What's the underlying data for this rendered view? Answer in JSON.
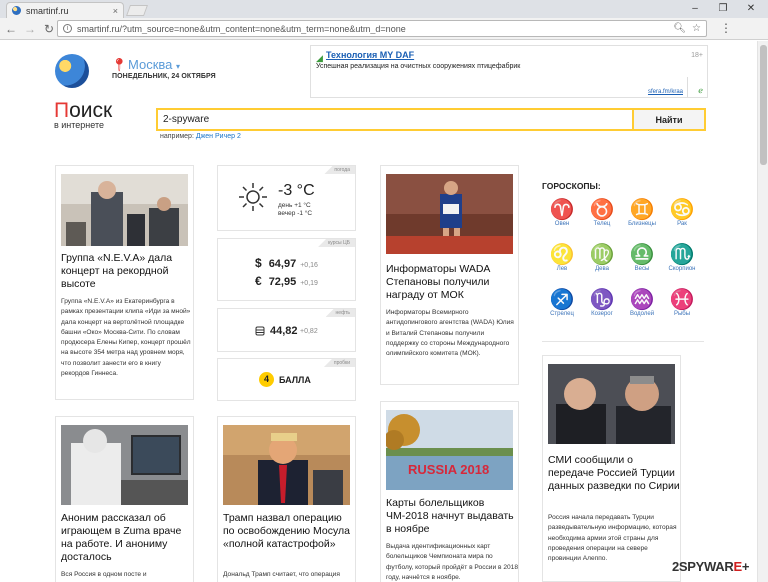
{
  "browser": {
    "tab_title": "smartinf.ru",
    "tab_close": "×",
    "url": "smartinf.ru/?utm_source=none&utm_content=none&utm_term=none&utm_d=none",
    "window_controls": [
      "–",
      "❐",
      "✕"
    ]
  },
  "header": {
    "city": "Москва",
    "date": "ПОНЕДЕЛЬНИК, 24 ОКТЯБРЯ"
  },
  "ad": {
    "title": "Технология MY DAF",
    "text": "Успешная реализация на очистных сооружениях птицефабрик",
    "age": "18+",
    "domain": "sfera.fm/kraa"
  },
  "brand": {
    "first_letter": "П",
    "rest": "оиск",
    "subtitle": "в интернете"
  },
  "search": {
    "value": "2-spyware",
    "button": "Найти",
    "example_prefix": "например:",
    "example_link": "Джен Ричер 2"
  },
  "news": [
    {
      "title": "Группа «N.E.V.A» дала концерт на рекордной высоте",
      "text": "Группа «N.E.V.A» из Екатеринбурга в рамках презентации клипа «Иди за мной» дала концерт на вертолётной площадке башни «Око» Москва-Сити. По словам продюсера Елены Кипер, концерт прошёл на высоте 354 метра над уровнем моря, что позволит занести его в книгу рекордов Гиннеса."
    },
    {
      "title": "Информаторы WADA Степановы получили награду от МОК",
      "text": "Информаторы Всемирного антидопингового агентства (WADA) Юлия и Виталий Степановы получили поддержку со стороны Международного олимпийского комитета (МОК)."
    },
    {
      "title": "Аноним рассказал об играющем в Zuma враче на работе. И анониму досталось",
      "text": "Вся Россия в одном посте и"
    },
    {
      "title": "Трамп назвал операцию по освобождению Мосула «полной катастрофой»",
      "text": "Дональд Трамп считает, что операция"
    },
    {
      "title": "Карты болельщиков ЧМ-2018 начнут выдавать в ноябре",
      "text": "Выдача идентификационных карт болельщиков Чемпионата мира по футболу, который пройдёт в России в 2018 году, начнётся в ноябре."
    },
    {
      "title": "СМИ сообщили о передаче Россией Турции данных разведки по Сирии",
      "text": "Россия начала передавать Турции разведывательную информацию, которая необходима армии этой страны для проведения операции на севере провинции Алеппо."
    }
  ],
  "weather": {
    "tag": "погода",
    "temp": "-3 °C",
    "day": "день +1 °C",
    "evening": "вечер -1 °C"
  },
  "rates": {
    "tag": "курсы ЦБ",
    "usd_symbol": "$",
    "usd": "64,97",
    "usd_change": "+0,16",
    "eur_symbol": "€",
    "eur": "72,95",
    "eur_change": "+0,19"
  },
  "oil": {
    "tag": "нефть",
    "value": "44,82",
    "change": "+0,82"
  },
  "traffic": {
    "tag": "пробки",
    "score": "4",
    "label": "БАЛЛА"
  },
  "horoscope": {
    "title": "ГОРОСКОПЫ:",
    "signs": [
      {
        "glyph": "♈",
        "name": "Овен"
      },
      {
        "glyph": "♉",
        "name": "Телец"
      },
      {
        "glyph": "♊",
        "name": "Близнецы"
      },
      {
        "glyph": "♋",
        "name": "Рак"
      },
      {
        "glyph": "♌",
        "name": "Лев"
      },
      {
        "glyph": "♍",
        "name": "Дева"
      },
      {
        "glyph": "♎",
        "name": "Весы"
      },
      {
        "glyph": "♏",
        "name": "Скорпион"
      },
      {
        "glyph": "♐",
        "name": "Стрелец"
      },
      {
        "glyph": "♑",
        "name": "Козерог"
      },
      {
        "glyph": "♒",
        "name": "Водолей"
      },
      {
        "glyph": "♓",
        "name": "Рыбы"
      }
    ]
  },
  "watermark": {
    "main": "2SPYWAR",
    "accent": "E",
    "suffix": "+"
  }
}
